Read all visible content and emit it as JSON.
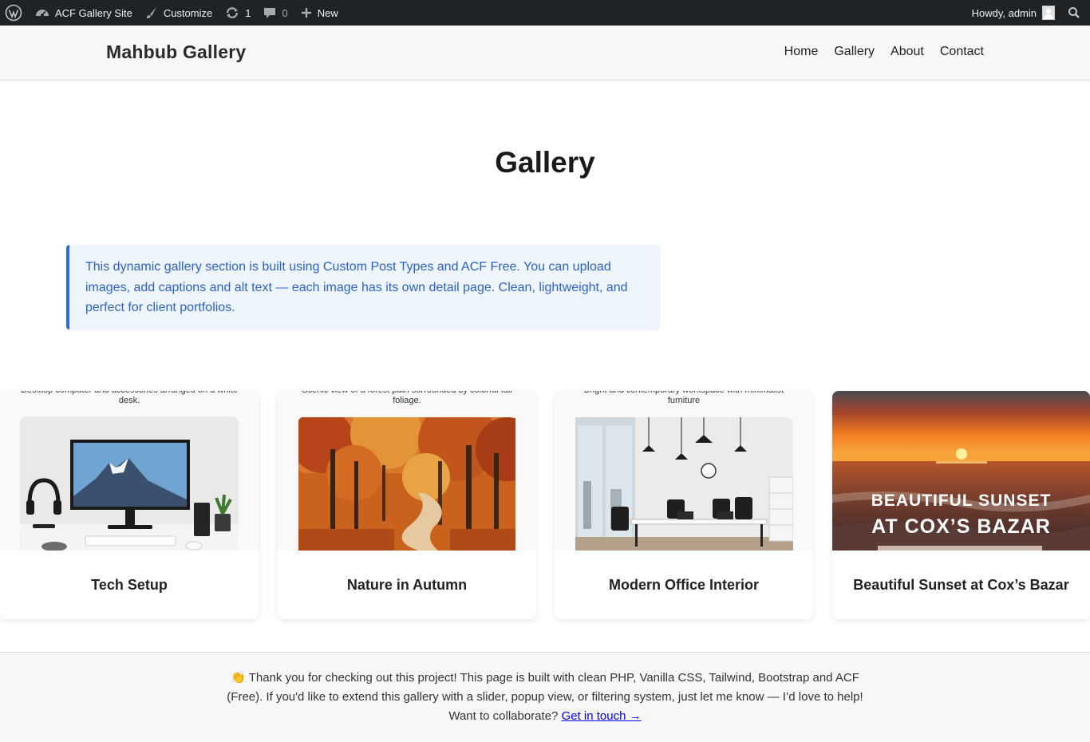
{
  "admin_bar": {
    "site_name": "ACF Gallery Site",
    "customize": "Customize",
    "updates_count": "1",
    "comments_count": "0",
    "new_label": "New",
    "howdy": "Howdy, admin"
  },
  "header": {
    "brand": "Mahbub Gallery",
    "nav": [
      "Home",
      "Gallery",
      "About",
      "Contact"
    ]
  },
  "page": {
    "title": "Gallery",
    "intro": "This dynamic gallery section is built using Custom Post Types and ACF Free. You can upload images, add captions and alt text — each image has its own detail page. Clean, lightweight, and perfect for client portfolios."
  },
  "gallery": [
    {
      "title": "Tech Setup",
      "caption": "Desktop computer and accessories arranged on a white desk."
    },
    {
      "title": "Nature in Autumn",
      "caption": "Scenic view of a forest path surrounded by colorful fall foliage."
    },
    {
      "title": "Modern Office Interior",
      "caption": "Bright and contemporary workspace with minimalist furniture"
    },
    {
      "title": "Beautiful Sunset at Cox’s Bazar",
      "overlay_line1": "BEAUTIFUL SUNSET",
      "overlay_line2": "AT COX’S BAZAR"
    }
  ],
  "footer": {
    "emoji": "👏",
    "text": "Thank you for checking out this project! This page is built with clean PHP, Vanilla CSS, Tailwind, Bootstrap and ACF (Free). If you'd like to extend this gallery with a slider, popup view, or filtering system, just let me know — I’d love to help!",
    "cta_prefix": "Want to collaborate?",
    "cta_link": "Get in touch →"
  },
  "colors": {
    "admin_bar_bg": "#1d2327",
    "intro_accent": "#2a6cdb",
    "intro_text": "#2c62c9"
  }
}
